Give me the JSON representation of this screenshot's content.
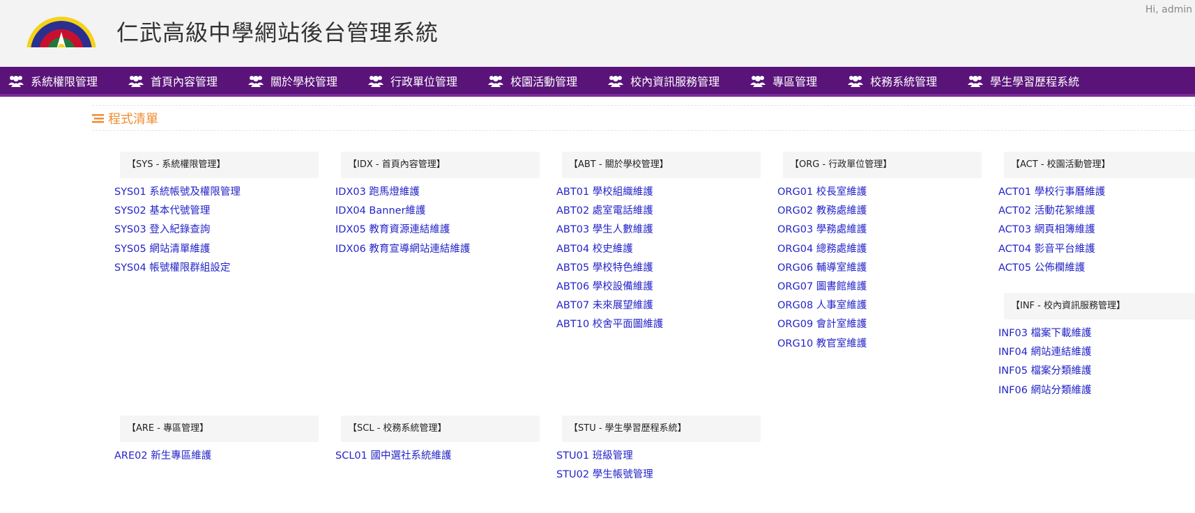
{
  "header": {
    "title": "仁武高級中學網站後台管理系統",
    "greeting": "Hi, admin",
    "logo_icon": "school-emblem-icon"
  },
  "nav": {
    "items": [
      {
        "label": "系統權限管理",
        "icon": "users-icon"
      },
      {
        "label": "首頁內容管理",
        "icon": "users-icon"
      },
      {
        "label": "關於學校管理",
        "icon": "users-icon"
      },
      {
        "label": "行政單位管理",
        "icon": "users-icon"
      },
      {
        "label": "校園活動管理",
        "icon": "users-icon"
      },
      {
        "label": "校內資訊服務管理",
        "icon": "users-icon"
      },
      {
        "label": "專區管理",
        "icon": "users-icon"
      },
      {
        "label": "校務系統管理",
        "icon": "users-icon"
      },
      {
        "label": "學生學習歷程系統",
        "icon": "users-icon"
      }
    ]
  },
  "section": {
    "title": "程式清單",
    "icon": "list-icon"
  },
  "groups": {
    "sys": {
      "title": "【SYS - 系統權限管理】",
      "items": [
        "SYS01 系統帳號及權限管理",
        "SYS02 基本代號管理",
        "SYS03 登入紀錄查詢",
        "SYS05 網站清單維護",
        "SYS04 帳號權限群組設定"
      ]
    },
    "idx": {
      "title": "【IDX - 首頁內容管理】",
      "items": [
        "IDX03 跑馬燈維護",
        "IDX04 Banner維護",
        "IDX05 教育資源連結維護",
        "IDX06 教育宣導網站連結維護"
      ]
    },
    "abt": {
      "title": "【ABT - 關於學校管理】",
      "items": [
        "ABT01 學校組織維護",
        "ABT02 處室電話維護",
        "ABT03 學生人數維護",
        "ABT04 校史維護",
        "ABT05 學校特色維護",
        "ABT06 學校設備維護",
        "ABT07 未來展望維護",
        "ABT10 校舍平面圖維護"
      ]
    },
    "org": {
      "title": "【ORG - 行政單位管理】",
      "items": [
        "ORG01 校長室維護",
        "ORG02 教務處維護",
        "ORG03 學務處維護",
        "ORG04 總務處維護",
        "ORG06 輔導室維護",
        "ORG07 圖書館維護",
        "ORG08 人事室維護",
        "ORG09 會計室維護",
        "ORG10 教官室維護"
      ]
    },
    "act": {
      "title": "【ACT - 校園活動管理】",
      "items": [
        "ACT01 學校行事曆維護",
        "ACT02 活動花絮維護",
        "ACT03 網頁相簿維護",
        "ACT04 影音平台維護",
        "ACT05 公佈欄維護"
      ]
    },
    "inf": {
      "title": "【INF - 校內資訊服務管理】",
      "items": [
        "INF03 檔案下載維護",
        "INF04 網站連結維護",
        "INF05 檔案分類維護",
        "INF06 網站分類維護"
      ]
    },
    "are": {
      "title": "【ARE - 專區管理】",
      "items": [
        "ARE02 新生專區維護"
      ]
    },
    "scl": {
      "title": "【SCL - 校務系統管理】",
      "items": [
        "SCL01 國中選社系統維護"
      ]
    },
    "stu": {
      "title": "【STU - 學生學習歷程系統】",
      "items": [
        "STU01 班級管理",
        "STU02 學生帳號管理"
      ]
    }
  },
  "colors": {
    "nav_bg": "#5a1479",
    "accent": "#f08c2e",
    "link": "#2424c8"
  }
}
